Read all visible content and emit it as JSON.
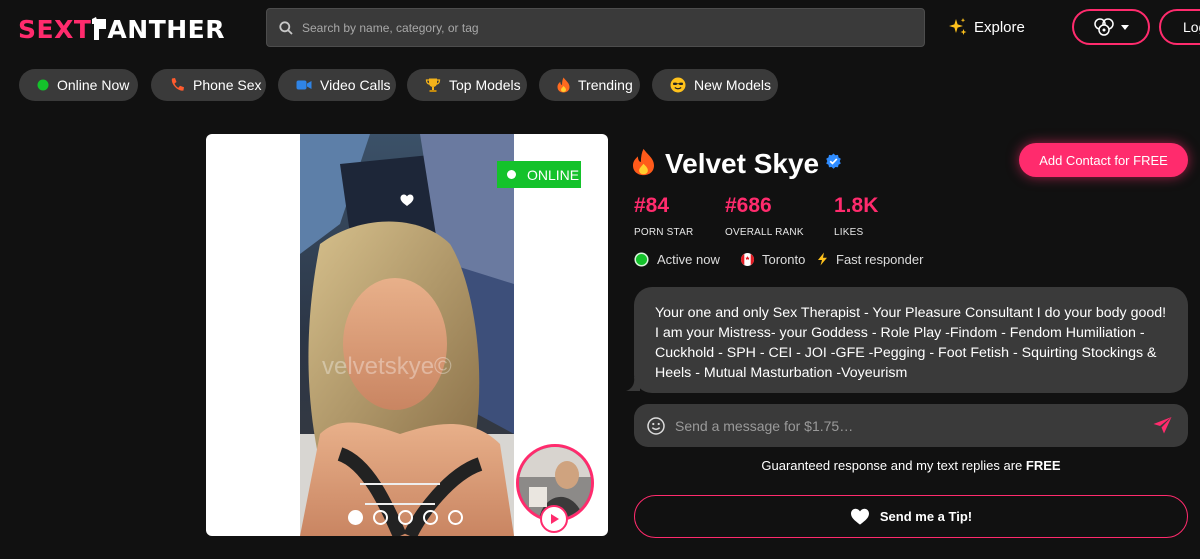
{
  "header": {
    "logo_part1": "SEXT",
    "logo_part2": "ANTHER",
    "search_placeholder": "Search by name, category, or tag",
    "explore_label": "Explore",
    "login_label": "Log"
  },
  "categories": [
    {
      "label": "Online Now",
      "icon": "green-dot-icon"
    },
    {
      "label": "Phone Sex",
      "icon": "phone-icon"
    },
    {
      "label": "Video Calls",
      "icon": "video-camera-icon"
    },
    {
      "label": "Top Models",
      "icon": "trophy-icon"
    },
    {
      "label": "Trending",
      "icon": "fire-icon"
    },
    {
      "label": "New Models",
      "icon": "smiley-icon"
    }
  ],
  "profile": {
    "name": "Velvet Skye",
    "online_label": "ONLINE",
    "watermark": "velvetskye©",
    "gallery": {
      "count": 5,
      "active_index": 0
    },
    "add_contact_label": "Add Contact for FREE",
    "stats": [
      {
        "value": "#84",
        "label": "PORN STAR"
      },
      {
        "value": "#686",
        "label": "OVERALL RANK"
      },
      {
        "value": "1.8K",
        "label": "LIKES"
      }
    ],
    "status": "Active now",
    "location": "Toronto",
    "responder": "Fast responder",
    "bio": "Your one and only Sex Therapist - Your Pleasure Consultant I do your body good! I am your Mistress- your Goddess - Role Play -Findom - Fendom Humiliation - Cuckhold - SPH - CEI - JOI -GFE -Pegging - Foot Fetish - Squirting Stockings & Heels - Mutual Masturbation -Voyeurism",
    "message_placeholder": "Send a message for $1.75…",
    "guarantee_text": "Guaranteed response and my text replies are",
    "guarantee_bold": "FREE",
    "tip_label": "Send me a Tip!"
  },
  "colors": {
    "accent": "#ff2b6d",
    "online": "#14c22b",
    "background": "#111111",
    "surface": "#3a3a3a"
  }
}
